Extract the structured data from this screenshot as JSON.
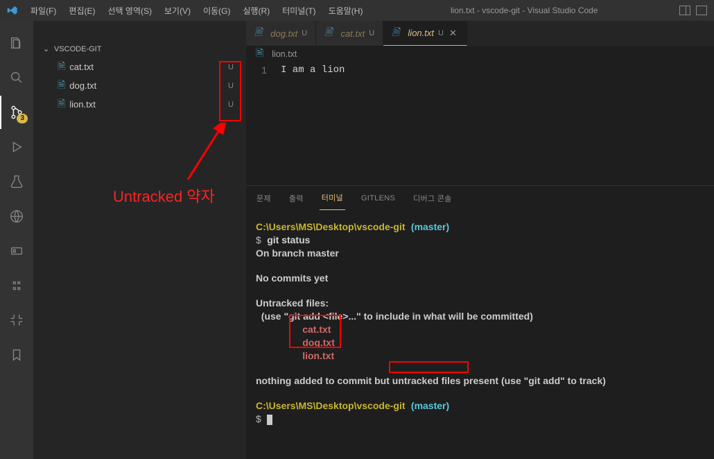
{
  "title": "lion.txt - vscode-git - Visual Studio Code",
  "menu": {
    "file": "파일(F)",
    "edit": "편집(E)",
    "selection": "선택 영역(S)",
    "view": "보기(V)",
    "go": "이동(G)",
    "run": "실행(R)",
    "terminal": "터미널(T)",
    "help": "도움말(H)"
  },
  "activity": {
    "scm_badge": "3"
  },
  "sidebar": {
    "folder": "VSCODE-GIT",
    "files": [
      {
        "name": "cat.txt",
        "status": "U"
      },
      {
        "name": "dog.txt",
        "status": "U"
      },
      {
        "name": "lion.txt",
        "status": "U"
      }
    ]
  },
  "tabs": [
    {
      "label": "dog.txt",
      "status": "U",
      "active": false
    },
    {
      "label": "cat.txt",
      "status": "U",
      "active": false
    },
    {
      "label": "lion.txt",
      "status": "U",
      "active": true
    }
  ],
  "breadcrumb": {
    "file": "lion.txt"
  },
  "editor": {
    "line1_num": "1",
    "line1_text": "I am a lion"
  },
  "panel": {
    "tabs": {
      "problems": "문제",
      "output": "출력",
      "terminal": "터미널",
      "gitlens": "GITLENS",
      "debug": "디버그 콘솔"
    }
  },
  "terminal": {
    "dir": "C:\\Users\\MS\\Desktop\\vscode-git",
    "branch": "(master)",
    "cmd1": "git status",
    "on_branch": "On branch master",
    "no_commits": "No commits yet",
    "untracked_header": "Untracked files:",
    "untracked_hint": "  (use \"git add <file>...\" to include in what will be committed)",
    "file1": "cat.txt",
    "file2": "dog.txt",
    "file3": "lion.txt",
    "nothing_pre": "nothing added to commit but ",
    "nothing_mid": "untracked files",
    "nothing_post": " present (use \"git add\" to track)",
    "dollar": "$"
  },
  "annotation": {
    "label": "Untracked 약자"
  }
}
